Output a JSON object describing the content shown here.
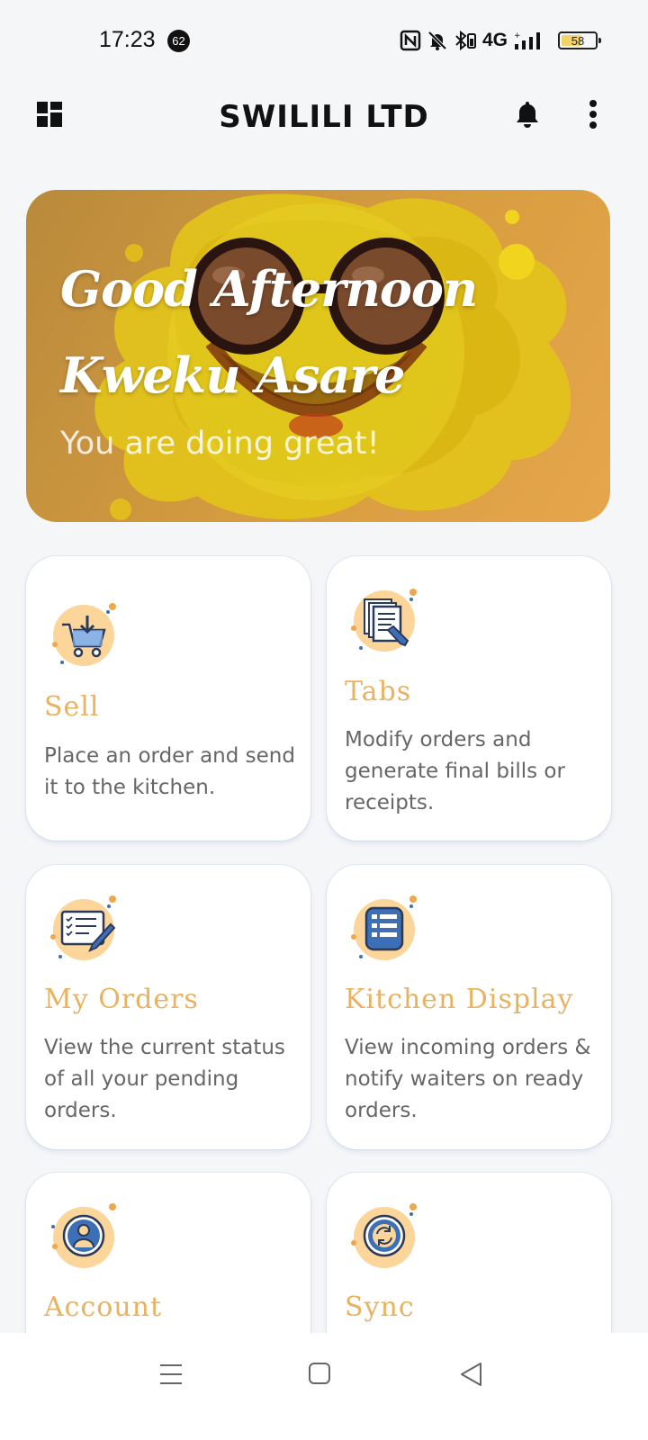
{
  "status_bar": {
    "time": "17:23",
    "notification_count": "62",
    "network": "4G",
    "battery": "58",
    "icons": [
      "nfc-icon",
      "mute-icon",
      "bluetooth-icon",
      "signal-icon",
      "battery-icon"
    ]
  },
  "app_bar": {
    "title": "SWILILI LTD",
    "icons": [
      "dashboard-grid-icon",
      "bell-icon",
      "more-vertical-icon"
    ]
  },
  "hero": {
    "greeting": "Good Afternoon",
    "name": "Kweku Asare",
    "subtitle": "You are doing great!"
  },
  "cards": [
    {
      "title": "Sell",
      "description": "Place an order and send it to the kitchen.",
      "icon": "cart-download-icon"
    },
    {
      "title": "Tabs",
      "description": "Modify orders and generate final bills or receipts.",
      "icon": "documents-pen-icon"
    },
    {
      "title": "My Orders",
      "description": "View the current status of all your pending orders.",
      "icon": "checklist-pen-icon"
    },
    {
      "title": "Kitchen Display",
      "description": "View incoming orders & notify waiters on ready orders.",
      "icon": "list-display-icon"
    },
    {
      "title": "Account",
      "description": "",
      "icon": "user-avatar-icon"
    },
    {
      "title": "Sync",
      "description": "",
      "icon": "sync-icon"
    }
  ],
  "colors": {
    "card_title": "#e8b260",
    "icon_circle": "#fbd59a",
    "icon_blue": "#3d6fb6"
  },
  "nav_bar": {
    "icons": [
      "menu-icon",
      "home-square-icon",
      "back-triangle-icon"
    ]
  }
}
